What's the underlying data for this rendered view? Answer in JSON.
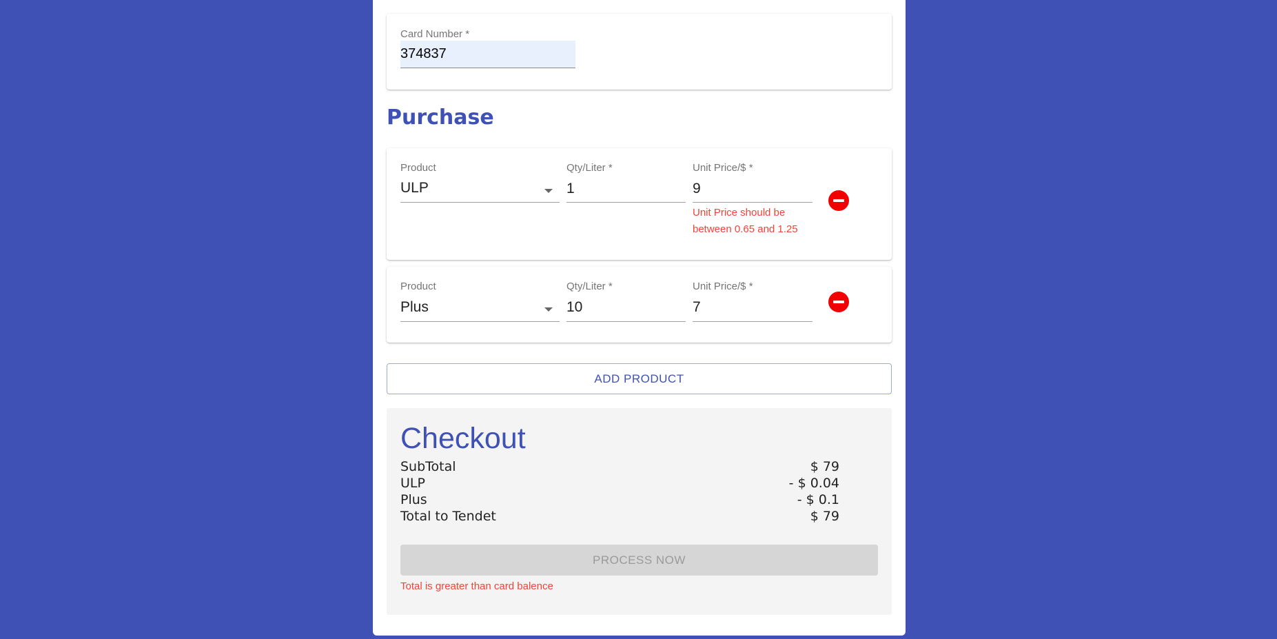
{
  "card_section": {
    "label": "Card Number *",
    "value": "374837"
  },
  "purchase": {
    "title": "Purchase",
    "items": [
      {
        "product_label": "Product",
        "product_value": "ULP",
        "qty_label": "Qty/Liter *",
        "qty_value": "1",
        "price_label": "Unit Price/$ *",
        "price_value": "9",
        "price_error": "Unit Price should be between 0.65 and 1.25"
      },
      {
        "product_label": "Product",
        "product_value": "Plus",
        "qty_label": "Qty/Liter *",
        "qty_value": "10",
        "price_label": "Unit Price/$ *",
        "price_value": "7",
        "price_error": ""
      }
    ],
    "add_product_label": "ADD PRODUCT"
  },
  "checkout": {
    "title": "Checkout",
    "rows": [
      {
        "label": "SubTotal",
        "value": "$ 79"
      },
      {
        "label": "ULP",
        "value": "- $ 0.04"
      },
      {
        "label": "Plus",
        "value": "- $ 0.1"
      },
      {
        "label": "Total to Tendet",
        "value": "$ 79"
      }
    ],
    "process_label": "PROCESS NOW",
    "error": "Total is greater than card balence"
  },
  "colors": {
    "primary": "#3f51b5",
    "error": "#f44336",
    "remove_button": "#f20000"
  },
  "icons": {
    "remove": "remove-circle-icon",
    "dropdown": "arrow-drop-down-icon"
  }
}
